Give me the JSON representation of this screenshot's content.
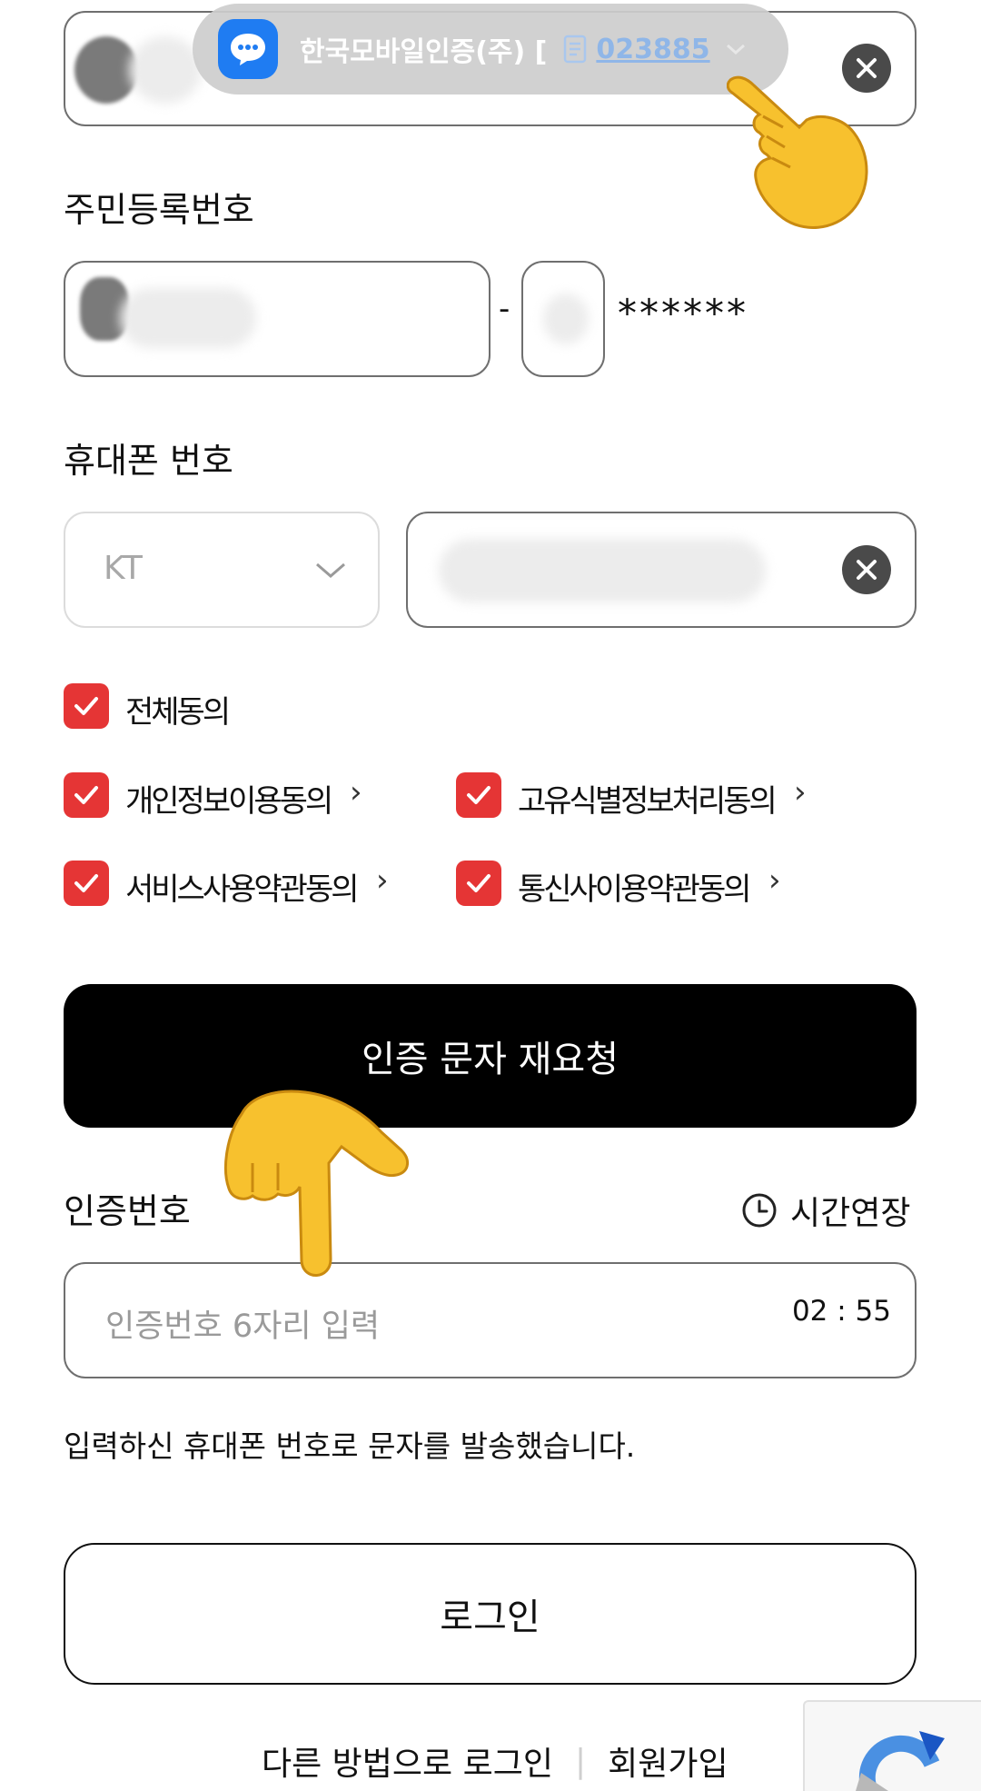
{
  "notification": {
    "app_name": "한국모바일인증(주) [",
    "code": "023885",
    "icon": "chat-bubble-icon"
  },
  "name_field": {
    "value_hidden": true
  },
  "resident_number": {
    "label": "주민등록번호",
    "separator": "-",
    "masked_suffix": "******"
  },
  "phone": {
    "label": "휴대폰 번호",
    "carrier": "KT"
  },
  "consents": {
    "all": "전체동의",
    "items": [
      {
        "label": "개인정보이용동의"
      },
      {
        "label": "고유식별정보처리동의"
      },
      {
        "label": "서비스사용약관동의"
      },
      {
        "label": "통신사이용약관동의"
      }
    ],
    "chevron": "›"
  },
  "resend_button": "인증 문자 재요청",
  "verification": {
    "label": "인증번호",
    "extend_label": "시간연장",
    "placeholder": "인증번호 6자리 입력",
    "timer": "02 : 55"
  },
  "notice": "입력하신 휴대폰 번호로 문자를 발송했습니다.",
  "login_button": "로그인",
  "footer": {
    "alt_login": "다른 방법으로 로그인",
    "divider": "|",
    "signup": "회원가입"
  },
  "colors": {
    "accent_red": "#e53535",
    "primary_black": "#000000",
    "notif_blue": "#1f7cf2"
  }
}
